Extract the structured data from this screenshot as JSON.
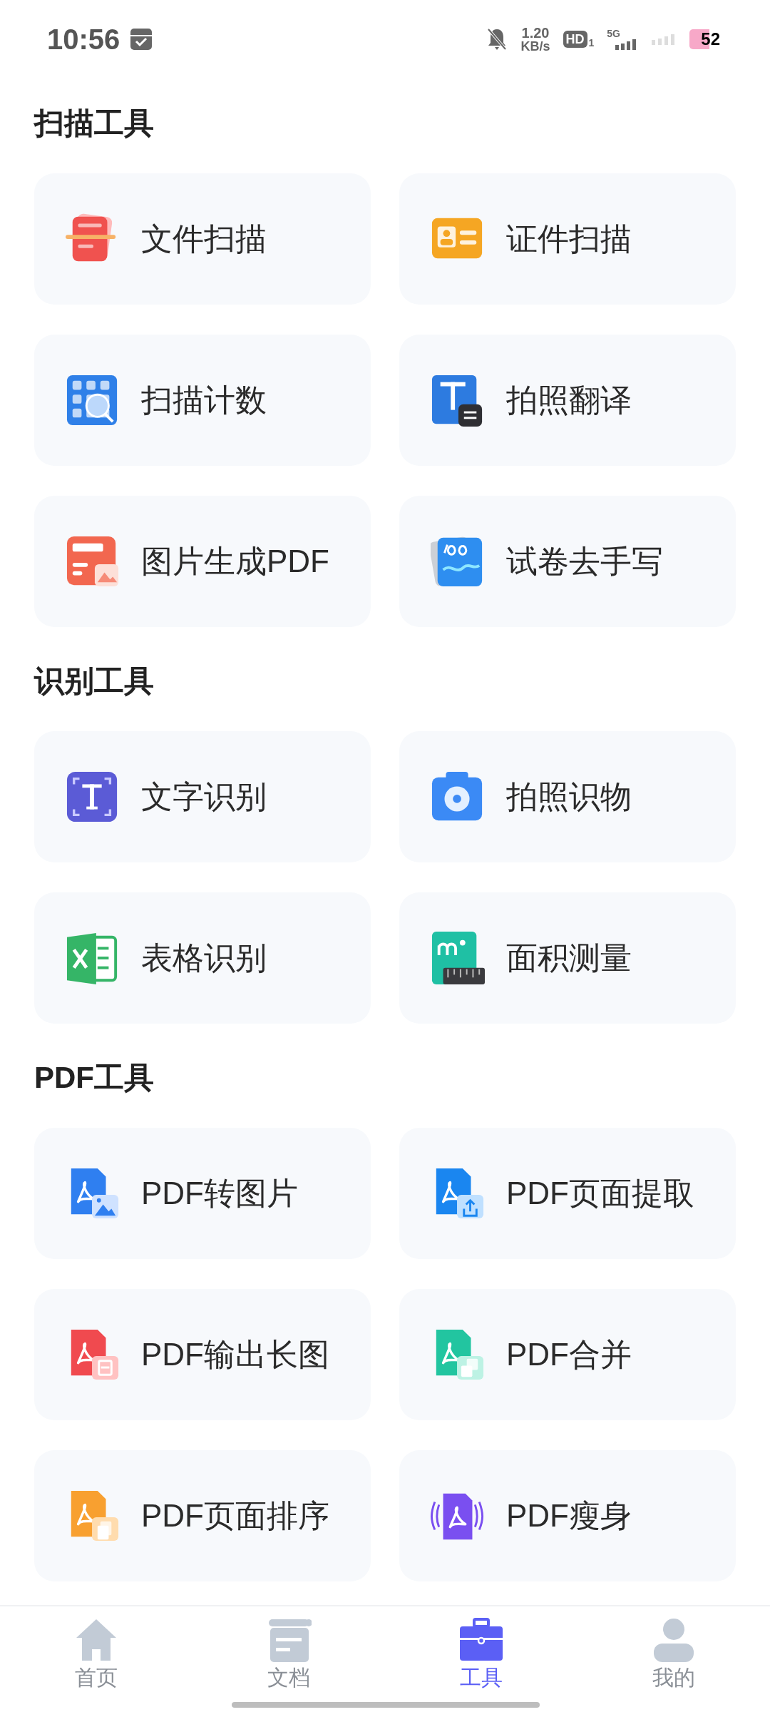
{
  "status_bar": {
    "time": "10:56",
    "speed": "1.20",
    "speed_unit": "KB/s",
    "hd": "HD",
    "hd_sub": "1",
    "network": "5G",
    "battery": "52"
  },
  "sections": [
    {
      "title": "扫描工具",
      "tools": [
        {
          "label": "文件扫描",
          "kind": "doc-scan",
          "color": "#f0524f"
        },
        {
          "label": "证件扫描",
          "kind": "id-card",
          "color": "#f5a623"
        },
        {
          "label": "扫描计数",
          "kind": "count",
          "color": "#2f80e8"
        },
        {
          "label": "拍照翻译",
          "kind": "translate",
          "color": "#2d7be0"
        },
        {
          "label": "图片生成PDF",
          "kind": "image-pdf",
          "color": "#f2674f"
        },
        {
          "label": "试卷去手写",
          "kind": "paper",
          "color": "#2e8ef0"
        }
      ]
    },
    {
      "title": "识别工具",
      "tools": [
        {
          "label": "文字识别",
          "kind": "ocr",
          "color": "#5b5bd6"
        },
        {
          "label": "拍照识物",
          "kind": "camera",
          "color": "#3b8af5"
        },
        {
          "label": "表格识别",
          "kind": "excel",
          "color": "#35b567"
        },
        {
          "label": "面积测量",
          "kind": "area",
          "color": "#1fc0a4"
        }
      ]
    },
    {
      "title": "PDF工具",
      "tools": [
        {
          "label": "PDF转图片",
          "kind": "pdf-image",
          "color": "#2f7ff0"
        },
        {
          "label": "PDF页面提取",
          "kind": "pdf-extract",
          "color": "#1a86f0"
        },
        {
          "label": "PDF输出长图",
          "kind": "pdf-long",
          "color": "#f04a4f"
        },
        {
          "label": "PDF合并",
          "kind": "pdf-merge",
          "color": "#22c5a0"
        },
        {
          "label": "PDF页面排序",
          "kind": "pdf-sort",
          "color": "#f8a030"
        },
        {
          "label": "PDF瘦身",
          "kind": "pdf-slim",
          "color": "#7a4ff0"
        }
      ]
    }
  ],
  "nav": [
    {
      "label": "首页",
      "kind": "home",
      "selected": false
    },
    {
      "label": "文档",
      "kind": "docs",
      "selected": false
    },
    {
      "label": "工具",
      "kind": "tools",
      "selected": true
    },
    {
      "label": "我的",
      "kind": "me",
      "selected": false
    }
  ]
}
